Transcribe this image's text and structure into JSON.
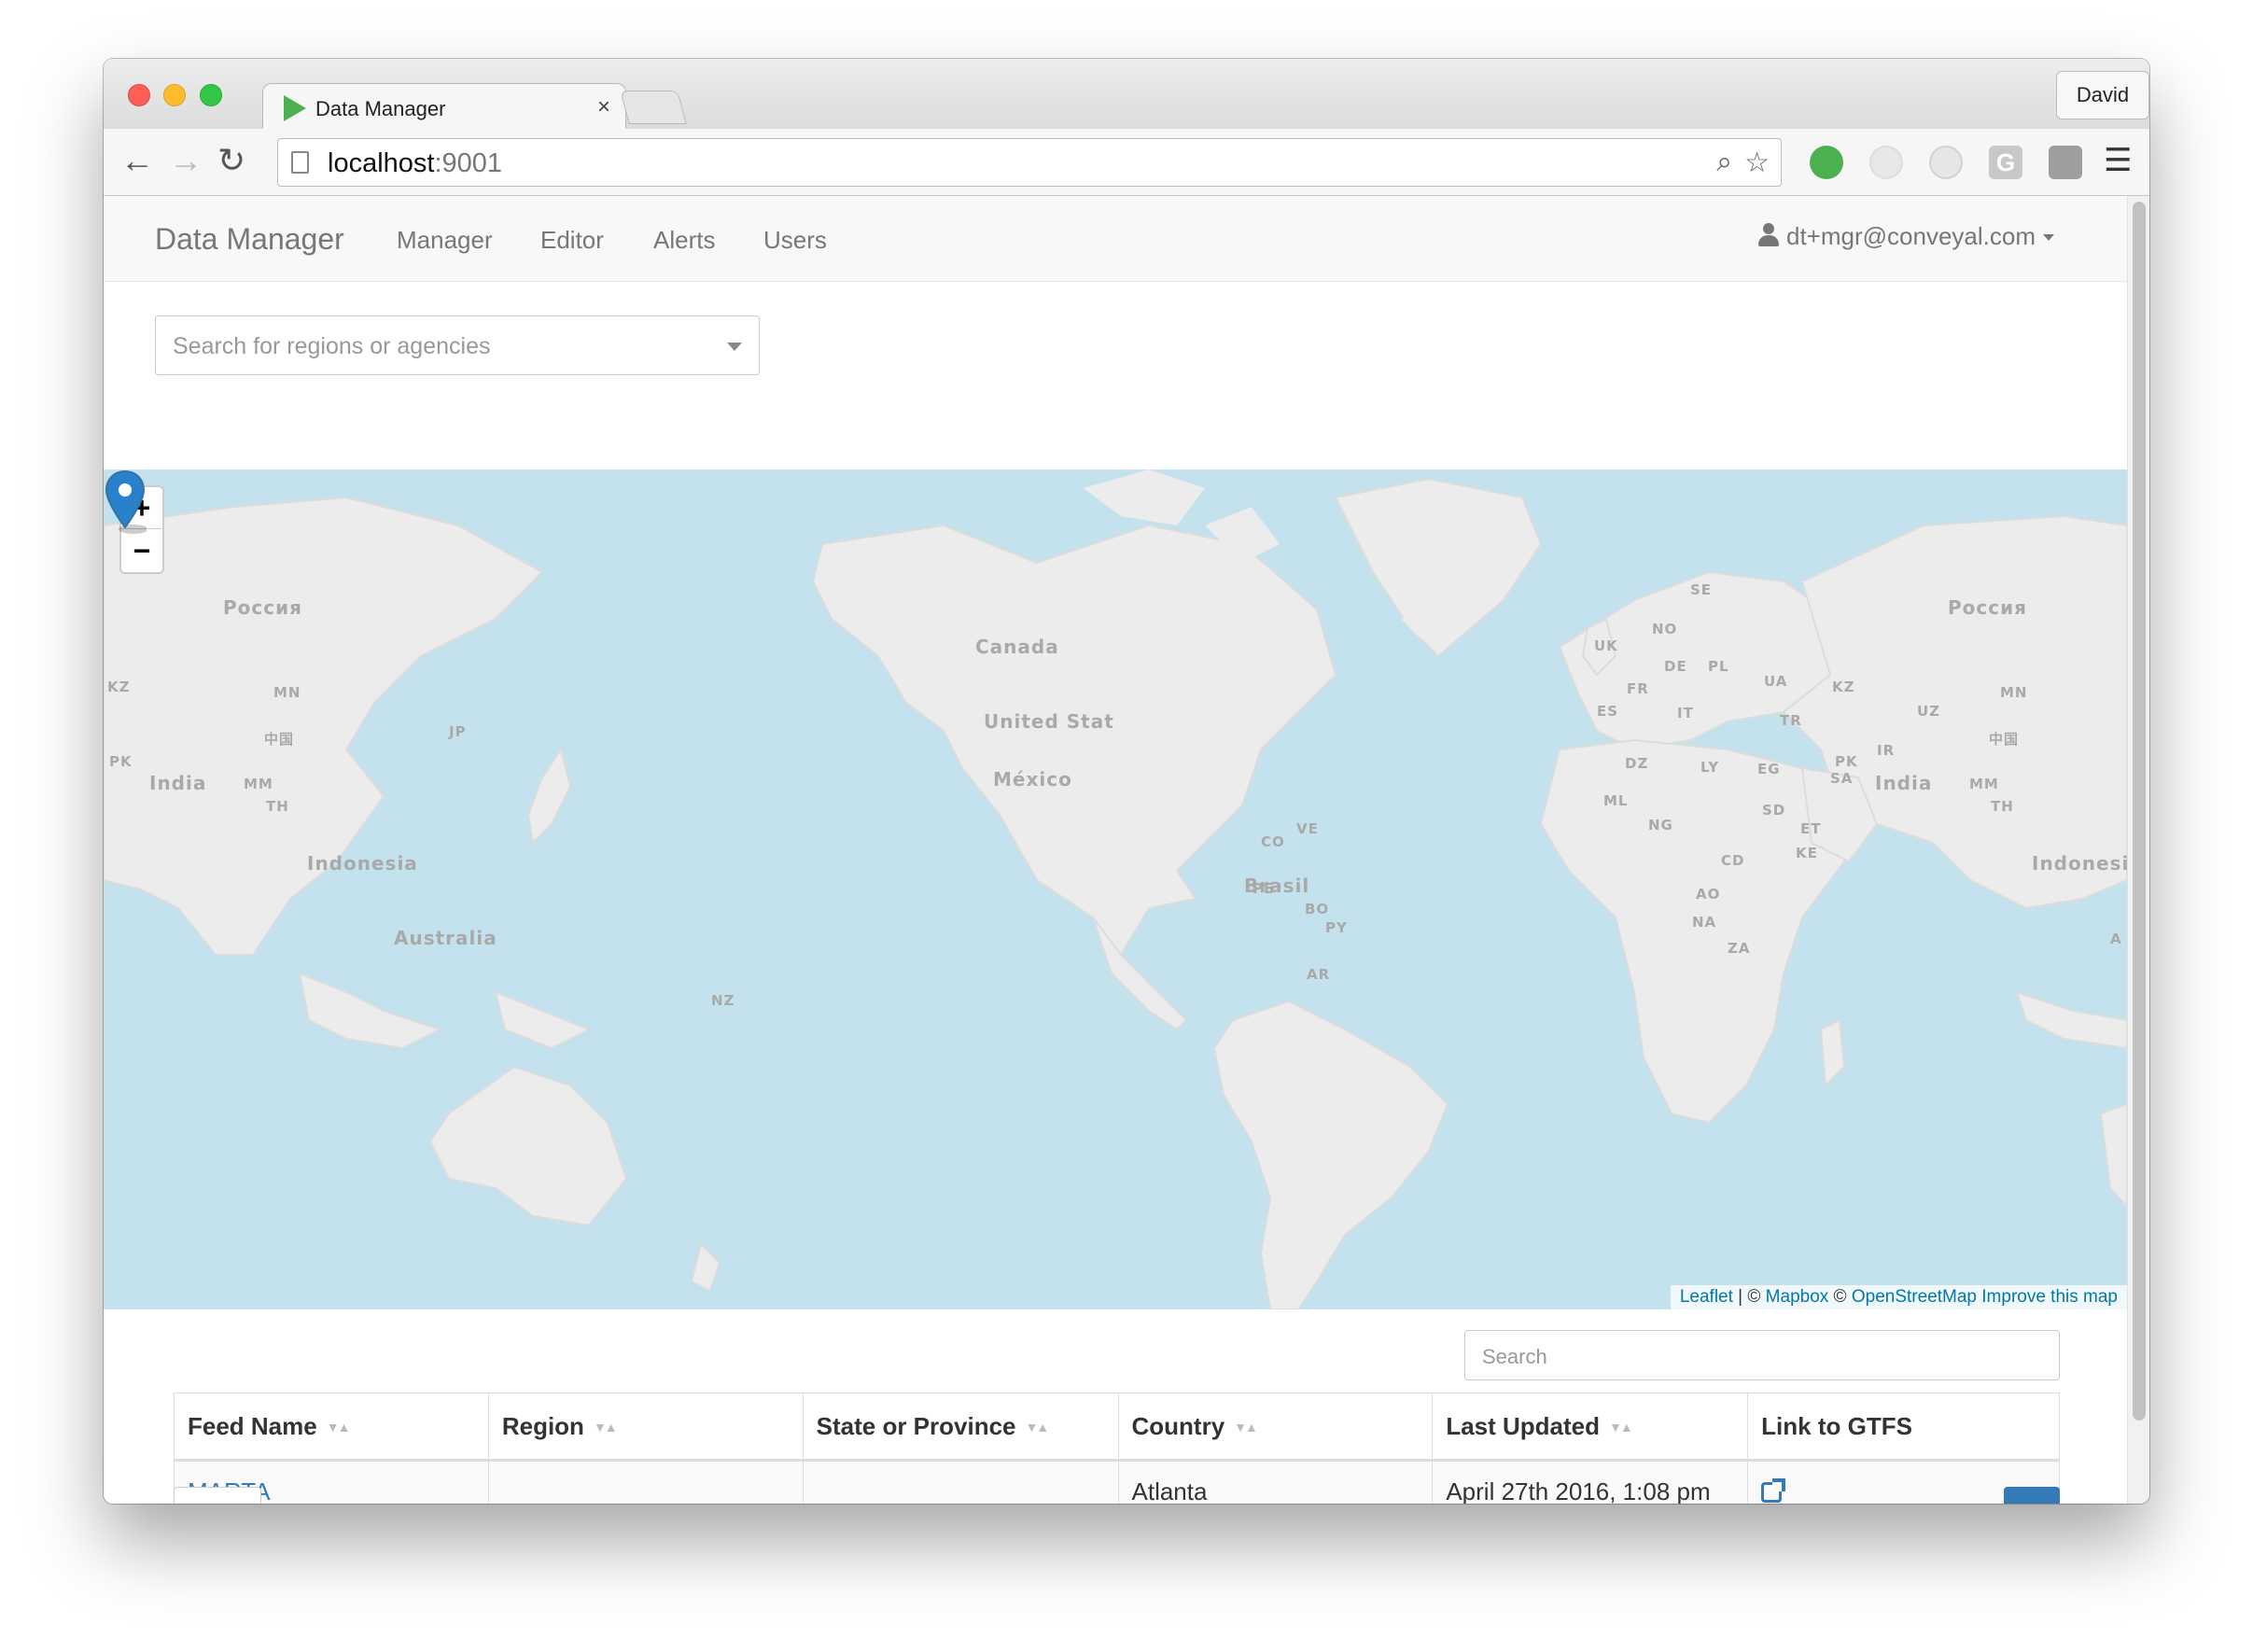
{
  "browser": {
    "tab_title": "Data Manager",
    "tab_close": "×",
    "profile_name": "David",
    "url_host": "localhost",
    "url_port": ":9001"
  },
  "navbar": {
    "brand": "Data Manager",
    "links": [
      "Manager",
      "Editor",
      "Alerts",
      "Users"
    ],
    "user_email": "dt+mgr@conveyal.com"
  },
  "region_search": {
    "placeholder": "Search for regions or agencies"
  },
  "map": {
    "zoom_in": "+",
    "zoom_out": "−",
    "labels": {
      "russia_west": "Россия",
      "russia_east": "Россия",
      "canada": "Canada",
      "united_states": "United Stat",
      "mexico": "México",
      "brasil": "Brasil",
      "australia": "Australia",
      "india_west": "India",
      "india_east": "India",
      "indonesia_west": "Indonesia",
      "indonesia_east": "Indonesia",
      "kz_west": "KZ",
      "kz_east": "KZ",
      "mn_west": "MN",
      "mn_east": "MN",
      "china_west": "中国",
      "china_east": "中国",
      "jp": "JP",
      "pk_west": "PK",
      "pk_east": "PK",
      "mm_west": "MM",
      "mm_east": "MM",
      "th_west": "TH",
      "th_east": "TH",
      "se": "SE",
      "no": "NO",
      "uk": "UK",
      "de": "DE",
      "pl": "PL",
      "ua": "UA",
      "fr": "FR",
      "es": "ES",
      "it": "IT",
      "tr": "TR",
      "uz": "UZ",
      "ir": "IR",
      "dz": "DZ",
      "ly": "LY",
      "eg": "EG",
      "sa": "SA",
      "ml": "ML",
      "sd": "SD",
      "ng": "NG",
      "et": "ET",
      "ke": "KE",
      "cd": "CD",
      "ao": "AO",
      "na": "NA",
      "za": "ZA",
      "ve": "VE",
      "co": "CO",
      "pe": "PE",
      "bo": "BO",
      "py": "PY",
      "ar": "AR",
      "nz": "NZ",
      "a": "A"
    },
    "attribution": {
      "leaflet": "Leaflet",
      "sep": " | © ",
      "mapbox": "Mapbox",
      "copy2": " © ",
      "osm": "OpenStreetMap",
      "improve": "Improve this map"
    }
  },
  "table": {
    "search_placeholder": "Search",
    "columns": [
      "Feed Name",
      "Region",
      "State or Province",
      "Country",
      "Last Updated",
      "Link to GTFS"
    ],
    "rows": [
      {
        "feed_name": "MARTA",
        "region": "",
        "state": "",
        "country": "Atlanta",
        "last_updated": "April 27th 2016, 1:08 pm"
      }
    ]
  },
  "colors": {
    "water": "#c3e2ee",
    "land": "#ececec",
    "link": "#337ab7",
    "marker": "#2a81cb"
  }
}
